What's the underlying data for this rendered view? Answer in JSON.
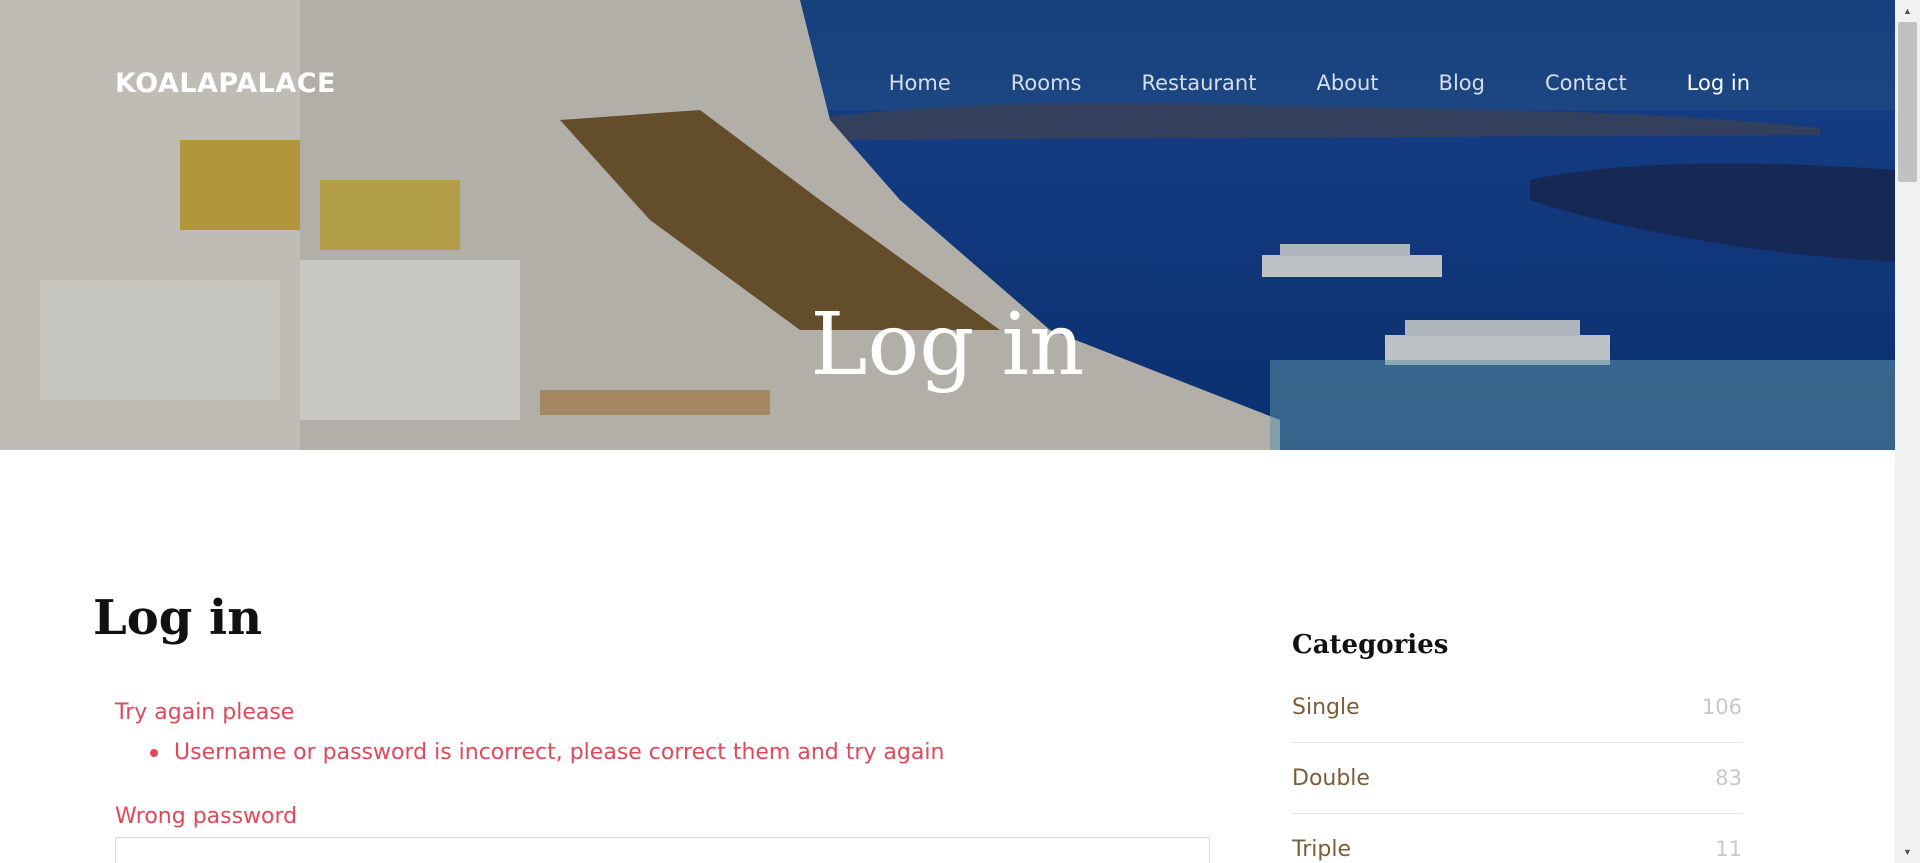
{
  "header": {
    "brand": "KOALAPALACE",
    "nav": [
      {
        "label": "Home",
        "active": false
      },
      {
        "label": "Rooms",
        "active": false
      },
      {
        "label": "Restaurant",
        "active": false
      },
      {
        "label": "About",
        "active": false
      },
      {
        "label": "Blog",
        "active": false
      },
      {
        "label": "Contact",
        "active": false
      },
      {
        "label": "Log in",
        "active": true
      }
    ],
    "hero_title": "Log in"
  },
  "main": {
    "title": "Log in",
    "error_title": "Try again please",
    "errors": [
      "Username or password is incorrect, please correct them and try again"
    ],
    "password_label": "Wrong password",
    "password_value": ""
  },
  "sidebar": {
    "title": "Categories",
    "categories": [
      {
        "name": "Single",
        "count": "106"
      },
      {
        "name": "Double",
        "count": "83"
      },
      {
        "name": "Triple",
        "count": "11"
      }
    ]
  },
  "colors": {
    "error": "#e0485b",
    "category_link": "#7a5e3a",
    "count": "#c8c8c8"
  }
}
